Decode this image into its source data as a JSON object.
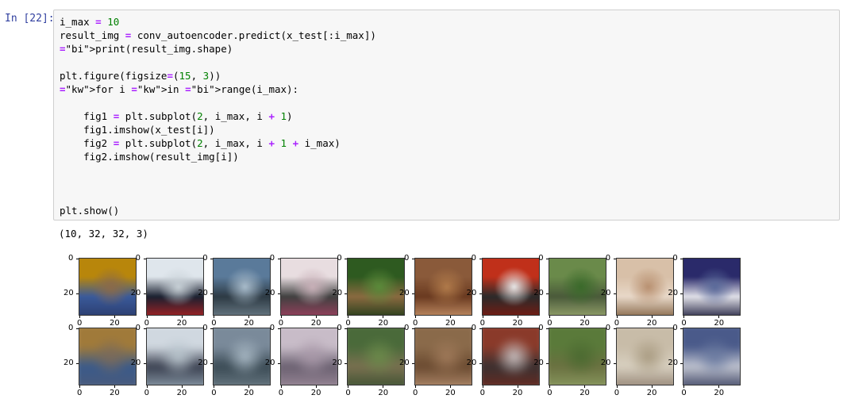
{
  "cell": {
    "prompt": "In [22]:",
    "code_lines": [
      "i_max = 10",
      "result_img = conv_autoencoder.predict(x_test[:i_max])",
      "print(result_img.shape)",
      "",
      "plt.figure(figsize=(15, 3))",
      "for i in range(i_max):",
      "",
      "    fig1 = plt.subplot(2, i_max, i + 1)",
      "    fig1.imshow(x_test[i])",
      "    fig2 = plt.subplot(2, i_max, i + 1 + i_max)",
      "    fig2.imshow(result_img[i])",
      "",
      "",
      "",
      "plt.show()"
    ]
  },
  "output": {
    "text": "(10, 32, 32, 3)",
    "y_tick_labels": [
      "0",
      "20"
    ],
    "x_tick_labels": [
      "0",
      "20"
    ],
    "originals": [
      {
        "name": "cat",
        "colors": [
          "#b8860b",
          "#8a6a4a",
          "#3a5a9a",
          "#2a3a6a"
        ]
      },
      {
        "name": "ship",
        "colors": [
          "#dfe6ec",
          "#c7d0d6",
          "#1a2030",
          "#b22222"
        ]
      },
      {
        "name": "ship",
        "colors": [
          "#5a7a9a",
          "#a9bccb",
          "#2d3a44",
          "#6e7f8a"
        ]
      },
      {
        "name": "airplane",
        "colors": [
          "#e8dde0",
          "#c8b0b8",
          "#404040",
          "#a04060"
        ]
      },
      {
        "name": "frog",
        "colors": [
          "#2e5a20",
          "#5a8a3a",
          "#8a6a40",
          "#1e3a18"
        ]
      },
      {
        "name": "frog",
        "colors": [
          "#8a5a3a",
          "#b07a4a",
          "#6a3a20",
          "#c8946a"
        ]
      },
      {
        "name": "automobile",
        "colors": [
          "#c0301a",
          "#e8e8e8",
          "#2a2a2a",
          "#801a10"
        ]
      },
      {
        "name": "frog",
        "colors": [
          "#6a8a4a",
          "#3a6a2a",
          "#4a5a3a",
          "#9aa870"
        ]
      },
      {
        "name": "cat",
        "colors": [
          "#d8c0a8",
          "#b89070",
          "#e8d8c8",
          "#806040"
        ]
      },
      {
        "name": "automobile",
        "colors": [
          "#2a2a6a",
          "#5a6a9a",
          "#e0e0e8",
          "#1a1a3a"
        ]
      }
    ],
    "reconstructions": [
      {
        "name": "cat",
        "colors": [
          "#a07a3a",
          "#7a6a5a",
          "#3a5a8a",
          "#4a5a7a"
        ]
      },
      {
        "name": "ship",
        "colors": [
          "#d0d8e0",
          "#b8c4cc",
          "#3a4050",
          "#8a9aa8"
        ]
      },
      {
        "name": "ship",
        "colors": [
          "#7a8a9a",
          "#a8b8c4",
          "#3a4a54",
          "#6a7a84"
        ]
      },
      {
        "name": "airplane",
        "colors": [
          "#c8bcc8",
          "#a898a8",
          "#6a6070",
          "#9a8898"
        ]
      },
      {
        "name": "frog",
        "colors": [
          "#4a6a3a",
          "#6a8a4a",
          "#7a7050",
          "#3a5030"
        ]
      },
      {
        "name": "frog",
        "colors": [
          "#8a6a4a",
          "#a07a5a",
          "#6a4a30",
          "#b08a6a"
        ]
      },
      {
        "name": "automobile",
        "colors": [
          "#8a3a2a",
          "#c8c0c0",
          "#3a3030",
          "#6a2a20"
        ]
      },
      {
        "name": "frog",
        "colors": [
          "#5a7a3a",
          "#4a6a30",
          "#6a7040",
          "#8a9a60"
        ]
      },
      {
        "name": "cat",
        "colors": [
          "#c8bca8",
          "#a89a80",
          "#d8d0c0",
          "#908070"
        ]
      },
      {
        "name": "automobile",
        "colors": [
          "#4a5a8a",
          "#6a7aa0",
          "#c0c4d0",
          "#3a4060"
        ]
      }
    ]
  }
}
